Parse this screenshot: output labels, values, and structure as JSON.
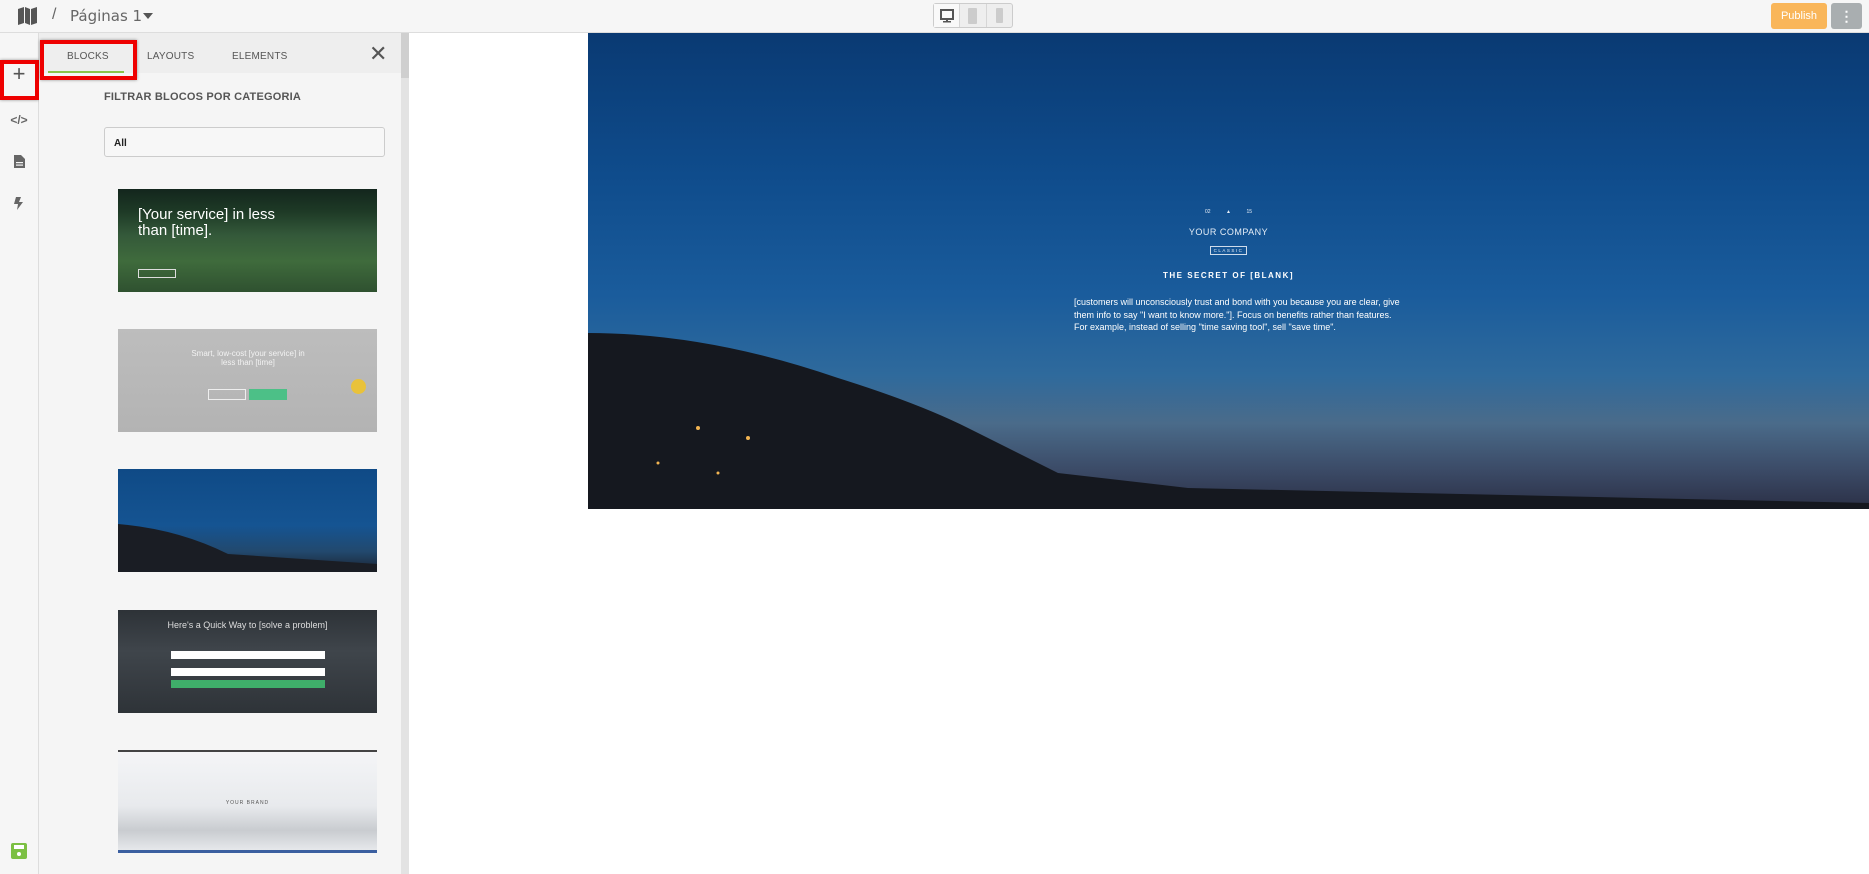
{
  "topbar": {
    "breadcrumb_separator": "/",
    "page_name": "Páginas 1",
    "publish_label": "Publish",
    "more_label": "⋮",
    "devices": [
      "desktop-icon",
      "tablet-icon",
      "mobile-icon"
    ]
  },
  "rail": {
    "items": [
      "plus-icon",
      "code-icon",
      "page-icon",
      "bolt-icon"
    ],
    "save": "save-icon"
  },
  "panel": {
    "tabs": [
      {
        "label": "BLOCKS",
        "active": true
      },
      {
        "label": "LAYOUTS"
      },
      {
        "label": "ELEMENTS"
      }
    ],
    "filter_label": "FILTRAR BLOCOS POR CATEGORIA",
    "filter_value": "All",
    "thumbnails": [
      {
        "title": "[Your service] in less than [time]."
      },
      {
        "title": "Smart, low-cost [your service] in less than [time]"
      },
      {
        "title": ""
      },
      {
        "title": "Here's a Quick Way to [solve a problem]"
      },
      {
        "title": "YOUR BRAND"
      }
    ]
  },
  "hero": {
    "logo_left": "02",
    "logo_right": "15",
    "logo_name": "YOUR COMPANY",
    "logo_sub": "CLASSIC",
    "title": "THE SECRET OF [BLANK]",
    "text": "[customers will unconsciously trust and bond with you because you are clear, give them info to say \"I want to know more.\"]. Focus on benefits rather than features. For example, instead of selling \"time saving tool\", sell \"save time\"."
  },
  "colors": {
    "accent_green": "#8bc34a",
    "publish": "#f9b65a",
    "highlight": "#ee0000",
    "save": "#7cc043"
  }
}
